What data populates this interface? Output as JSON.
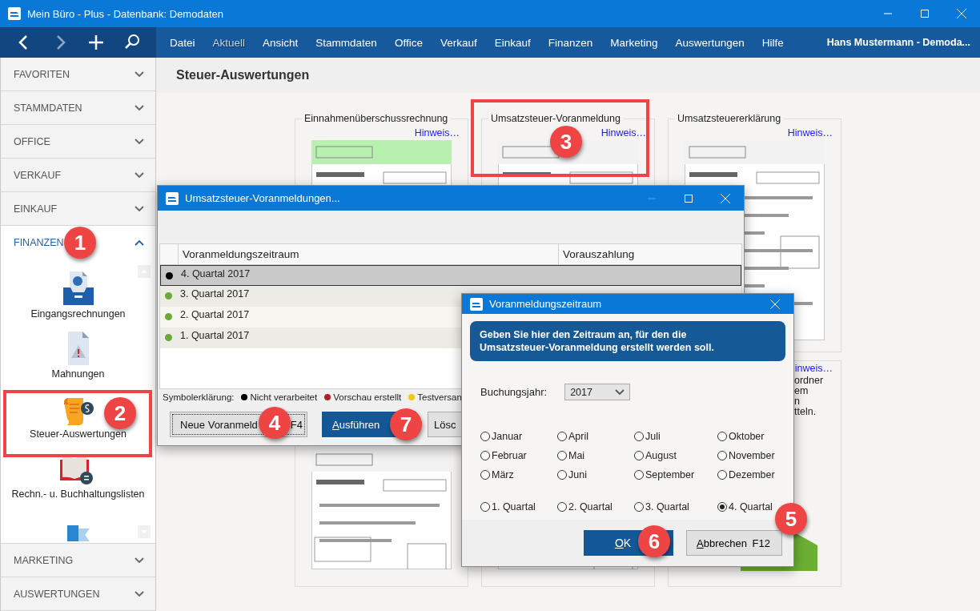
{
  "window": {
    "title": "Mein Büro - Plus - Datenbank: Demodaten"
  },
  "menu": [
    {
      "label": "Datei",
      "disabled": false
    },
    {
      "label": "Aktuell",
      "disabled": true
    },
    {
      "label": "Ansicht",
      "disabled": false
    },
    {
      "label": "Stammdaten",
      "disabled": false
    },
    {
      "label": "Office",
      "disabled": false
    },
    {
      "label": "Verkauf",
      "disabled": false
    },
    {
      "label": "Einkauf",
      "disabled": false
    },
    {
      "label": "Finanzen",
      "disabled": false
    },
    {
      "label": "Marketing",
      "disabled": false
    },
    {
      "label": "Auswertungen",
      "disabled": false
    },
    {
      "label": "Hilfe",
      "disabled": false
    }
  ],
  "user": "Hans Mustermann - Demoda...",
  "sidebar": {
    "sections": [
      {
        "label": "FAVORITEN",
        "expanded": false
      },
      {
        "label": "STAMMDATEN",
        "expanded": false
      },
      {
        "label": "OFFICE",
        "expanded": false
      },
      {
        "label": "VERKAUF",
        "expanded": false
      },
      {
        "label": "EINKAUF",
        "expanded": false
      },
      {
        "label": "FINANZEN",
        "expanded": true,
        "items": [
          "Eingangsrechnungen",
          "Mahnungen",
          "Steuer-Auswertungen",
          "Rechn.- u. Buchhaltungslisten"
        ]
      },
      {
        "label": "MARKETING",
        "expanded": false
      },
      {
        "label": "AUSWERTUNGEN",
        "expanded": false
      }
    ]
  },
  "page_title": "Steuer-Auswertungen",
  "cards": [
    {
      "title": "Einnahmenüberschussrechnung",
      "link": "Hinweis…"
    },
    {
      "title": "Umsatzsteuer-Voranmeldung",
      "link": "Hinweis…"
    },
    {
      "title": "Umsatzsteuererklärung",
      "link": "Hinweis…"
    }
  ],
  "bottom_card": {
    "link": "inweis…",
    "lines": [
      "ordner",
      "em",
      "n",
      "tteln."
    ]
  },
  "dialog": {
    "title": "Umsatzsteuer-Voranmeldungen...",
    "columns": [
      "Voranmeldungszeitraum",
      "Vorauszahlung"
    ],
    "rows": [
      {
        "period": "4. Quartal 2017",
        "color": "#000000",
        "selected": true
      },
      {
        "period": "3. Quartal 2017",
        "color": "#6aaa3a",
        "selected": false
      },
      {
        "period": "2. Quartal 2017",
        "color": "#6aaa3a",
        "selected": false
      },
      {
        "period": "1. Quartal 2017",
        "color": "#6aaa3a",
        "selected": false
      }
    ],
    "legend_label": "Symbolerklärung:",
    "legend": [
      {
        "label": "Nicht verarbeitet",
        "color": "#000000"
      },
      {
        "label": "Vorschau erstellt",
        "color": "#b5202a"
      },
      {
        "label": "Testversan",
        "color": "#f5c518"
      }
    ],
    "buttons": [
      {
        "label": "Neue Voranmeld",
        "shortcut": "F4",
        "kind": "default"
      },
      {
        "label": "Ausführen",
        "kind": "primary"
      },
      {
        "label": "Lösc",
        "kind": "plain"
      }
    ]
  },
  "period_dialog": {
    "title": "Voranmeldungszeitraum",
    "info": "Geben Sie hier den Zeitraum an, für den die Umsatzsteuer-Voranmeldung erstellt werden soll.",
    "year_label": "Buchungsjahr:",
    "year": "2017",
    "options": [
      {
        "label": "Januar",
        "selected": false
      },
      {
        "label": "April",
        "selected": false
      },
      {
        "label": "Juli",
        "selected": false
      },
      {
        "label": "Oktober",
        "selected": false
      },
      {
        "label": "Februar",
        "selected": false
      },
      {
        "label": "Mai",
        "selected": false
      },
      {
        "label": "August",
        "selected": false
      },
      {
        "label": "November",
        "selected": false
      },
      {
        "label": "März",
        "selected": false
      },
      {
        "label": "Juni",
        "selected": false
      },
      {
        "label": "September",
        "selected": false
      },
      {
        "label": "Dezember",
        "selected": false
      }
    ],
    "quarters": [
      {
        "label": "1. Quartal",
        "selected": false
      },
      {
        "label": "2. Quartal",
        "selected": false
      },
      {
        "label": "3. Quartal",
        "selected": false
      },
      {
        "label": "4. Quartal",
        "selected": true
      }
    ],
    "ok": "OK",
    "cancel": "Abbrechen",
    "cancel_shortcut": "F12"
  },
  "callouts": [
    "1",
    "2",
    "3",
    "4",
    "5",
    "6",
    "7"
  ]
}
